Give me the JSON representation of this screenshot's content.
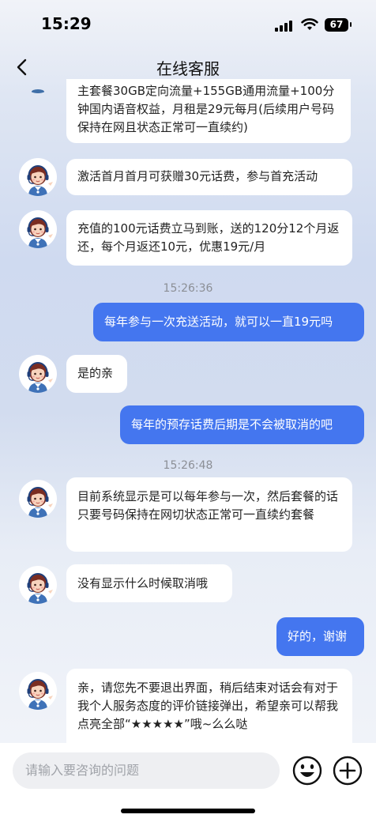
{
  "status_bar": {
    "time": "15:29",
    "battery": "67"
  },
  "header": {
    "title": "在线客服"
  },
  "messages": [
    {
      "text": "主套餐30GB定向流量+155GB通用流量+100分钟国内语音权益，月租是29元每月(后续用户号码保持在网且状态正常可一直续约)"
    },
    {
      "text": "激活首月首月可获赠30元话费，参与首充活动"
    },
    {
      "text": "充值的100元话费立马到账，送的120分12个月返还，每个月返还10元，优惠19元/月"
    },
    {
      "text": "15:26:36"
    },
    {
      "text": "每年参与一次充送活动，就可以一直19元吗"
    },
    {
      "text": "是的亲"
    },
    {
      "text": "每年的预存话费后期是不会被取消的吧"
    },
    {
      "text": "15:26:48"
    },
    {
      "text": "目前系统显示是可以每年参与一次，然后套餐的话 只要号码保持在网切状态正常可一直续约套餐"
    },
    {
      "text": "没有显示什么时候取消哦"
    },
    {
      "text": "好的，谢谢"
    },
    {
      "text": "亲，请您先不要退出界面，稍后结束对话会有对于我个人服务态度的评价链接弹出，希望亲可以帮我点亮全部“★★★★★”哦~么么哒"
    }
  ],
  "input": {
    "placeholder": "请输入要咨询的问题"
  },
  "icons": {
    "back": "chevron-left-icon",
    "emoji": "emoji-icon",
    "add": "plus-circle-icon"
  }
}
